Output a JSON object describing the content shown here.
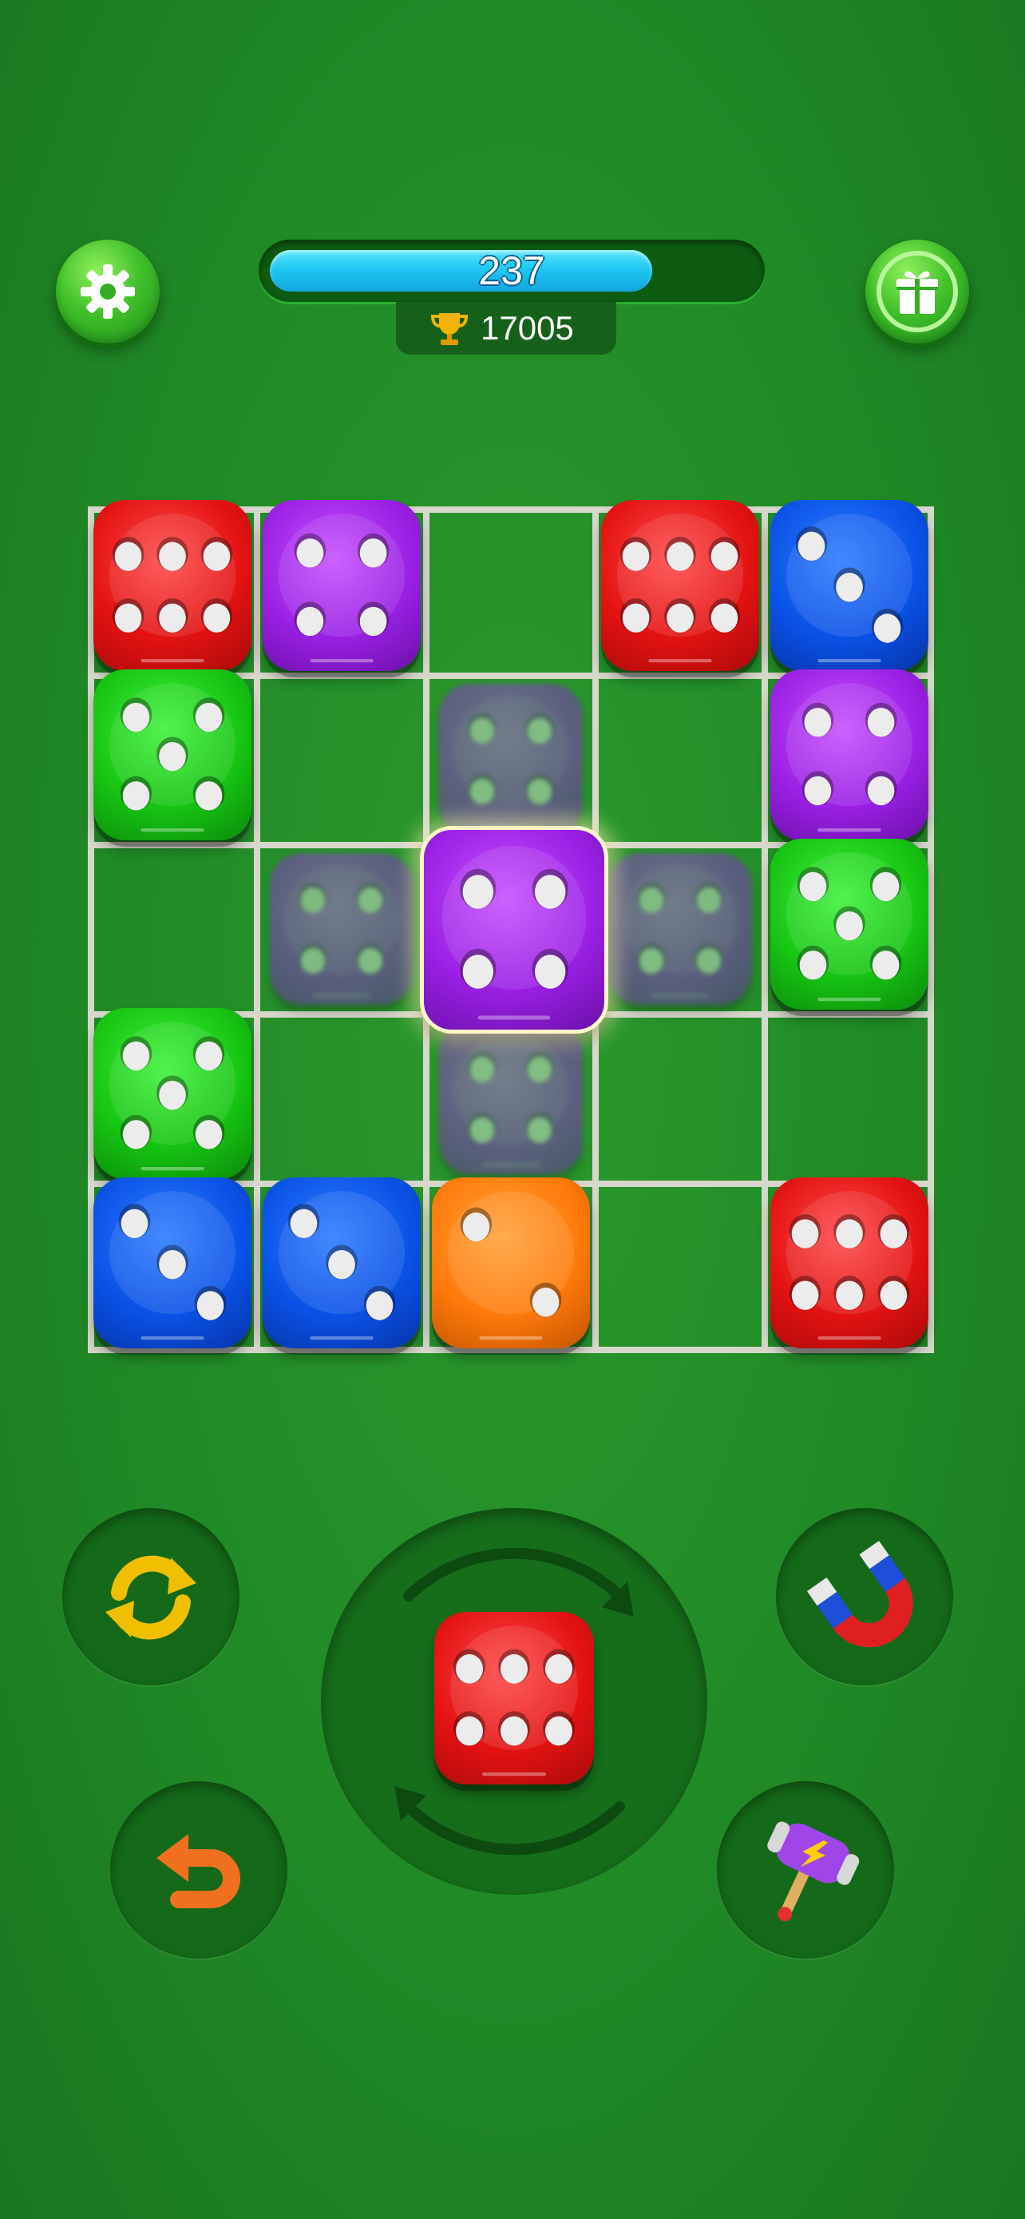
{
  "header": {
    "progress_value": "237",
    "progress_fraction": 0.79,
    "score": "17005",
    "settings_icon": "gear-icon",
    "gift_icon": "gift-icon",
    "trophy_icon": "trophy-icon"
  },
  "board": {
    "rows": 5,
    "cols": 5,
    "cells": [
      {
        "row": 0,
        "col": 0,
        "color": "red",
        "pips": 6
      },
      {
        "row": 0,
        "col": 1,
        "color": "purple",
        "pips": 4
      },
      {
        "row": 0,
        "col": 3,
        "color": "red",
        "pips": 6
      },
      {
        "row": 0,
        "col": 4,
        "color": "blue",
        "pips": 3
      },
      {
        "row": 1,
        "col": 0,
        "color": "green",
        "pips": 5
      },
      {
        "row": 1,
        "col": 4,
        "color": "purple",
        "pips": 4
      },
      {
        "row": 2,
        "col": 2,
        "color": "purple",
        "pips": 4,
        "selected": true
      },
      {
        "row": 2,
        "col": 4,
        "color": "green",
        "pips": 5
      },
      {
        "row": 3,
        "col": 0,
        "color": "green",
        "pips": 5
      },
      {
        "row": 4,
        "col": 0,
        "color": "blue",
        "pips": 3
      },
      {
        "row": 4,
        "col": 1,
        "color": "blue",
        "pips": 3
      },
      {
        "row": 4,
        "col": 2,
        "color": "orange",
        "pips": 2
      },
      {
        "row": 4,
        "col": 4,
        "color": "red",
        "pips": 6
      }
    ]
  },
  "next_die": {
    "color": "red",
    "pips": 6
  },
  "controls": {
    "refresh_icon": "refresh-icon",
    "undo_icon": "undo-icon",
    "magnet_icon": "magnet-icon",
    "hammer_icon": "hammer-icon",
    "rotate_icon": "rotate-arrows-icon"
  },
  "colors": {
    "background": "#208a26",
    "red": "#e31212",
    "purple": "#9a20e4",
    "blue": "#0a52e6",
    "green": "#16c412",
    "orange": "#ff7a0a",
    "progress": "#1ec7f2"
  }
}
